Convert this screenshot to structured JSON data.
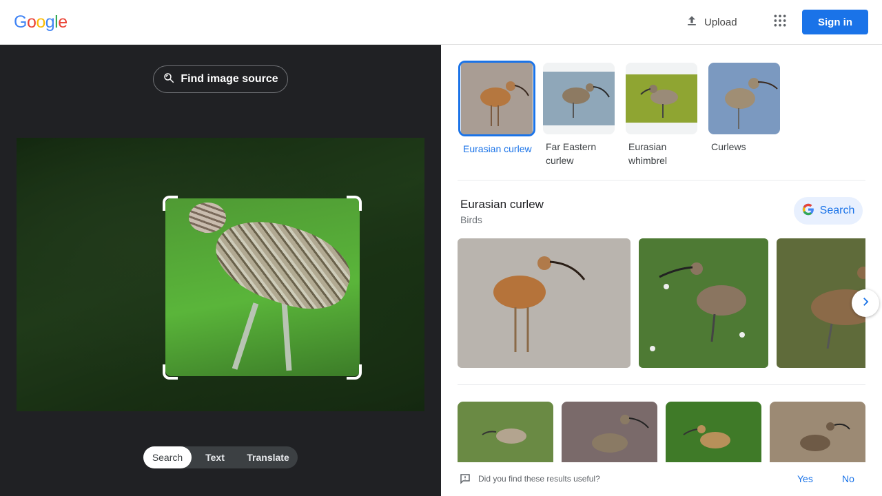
{
  "header": {
    "logo_letters": [
      "G",
      "o",
      "o",
      "g",
      "l",
      "e"
    ],
    "logo_colors": [
      "#4285f4",
      "#ea4335",
      "#fbbc05",
      "#4285f4",
      "#34a853",
      "#ea4335"
    ],
    "upload_label": "Upload",
    "signin_label": "Sign in"
  },
  "left_panel": {
    "find_source_label": "Find image source",
    "modes": [
      {
        "label": "Search",
        "active": true
      },
      {
        "label": "Text",
        "active": false
      },
      {
        "label": "Translate",
        "active": false
      }
    ]
  },
  "chips": [
    {
      "label": "Eurasian curlew",
      "selected": true
    },
    {
      "label": "Far Eastern curlew",
      "selected": false
    },
    {
      "label": "Eurasian whimbrel",
      "selected": false
    },
    {
      "label": "Curlews",
      "selected": false
    }
  ],
  "knowledge": {
    "title": "Eurasian curlew",
    "subtitle": "Birds",
    "search_label": "Search"
  },
  "feedback": {
    "question": "Did you find these results useful?",
    "yes_label": "Yes",
    "no_label": "No"
  },
  "colors": {
    "accent": "#1a73e8",
    "dark_panel": "#202124"
  }
}
